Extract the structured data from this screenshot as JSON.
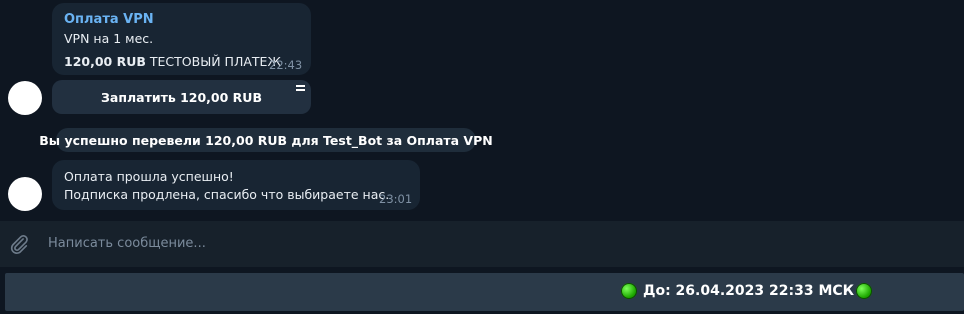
{
  "messages": {
    "invoice": {
      "title": "Оплата VPN",
      "description": "VPN на 1 мес.",
      "amount": "120,00 RUB",
      "amount_note": "ТЕСТОВЫЙ ПЛАТЕЖ",
      "time": "22:43"
    },
    "pay_button": {
      "label": "Заплатить 120,00 RUB"
    },
    "service": {
      "text": "Вы успешно перевели 120,00 RUB для Test_Bot за Оплата VPN"
    },
    "confirmation": {
      "line1": "Оплата прошла успешно!",
      "line2": "Подписка продлена, спасибо что выбираете нас.",
      "time": "23:01"
    }
  },
  "composer": {
    "placeholder": "Написать сообщение..."
  },
  "bottom_bar": {
    "status_text": "До: 26.04.2023 22:33 МСК"
  },
  "icons": {
    "attach": "paperclip-icon",
    "status_dot": "green-circle-icon",
    "button_corner": "inline-button-icon"
  },
  "colors": {
    "background": "#0e1621",
    "bubble": "#182533",
    "accent_title": "#6ab3f3",
    "composer": "#17212b",
    "bottom_bar": "#2b3a49",
    "status_dot": "#1ea800"
  }
}
